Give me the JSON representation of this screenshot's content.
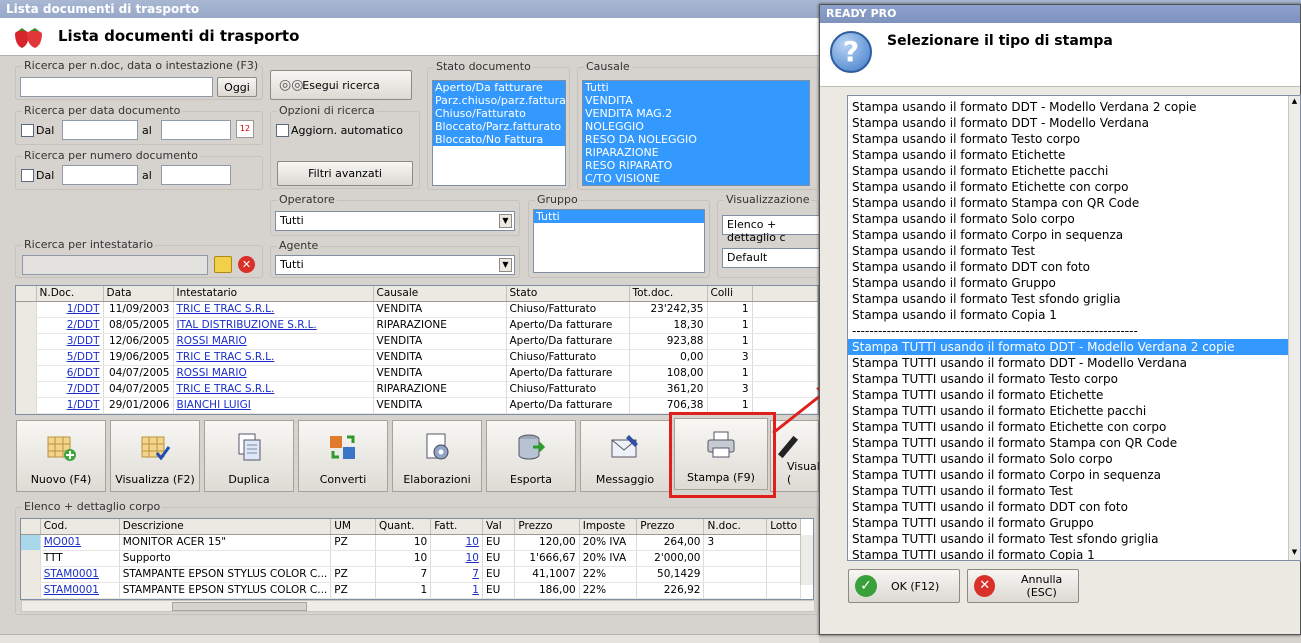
{
  "window": {
    "title": "Lista documenti di trasporto"
  },
  "header": {
    "title": "Lista documenti di trasporto"
  },
  "search": {
    "ndoc_label": "Ricerca per n.doc, data o intestazione (F3)",
    "ndoc_value": "",
    "oggi_label": "Oggi",
    "execute_label": "Esegui ricerca",
    "date_label": "Ricerca per data documento",
    "dal_label": "Dal",
    "al_label": "al",
    "num_label": "Ricerca per numero documento",
    "options_label": "Opzioni di ricerca",
    "auto_update_label": "Aggiorn. automatico",
    "advanced_filters_label": "Filtri avanzati",
    "intestatario_label": "Ricerca per intestatario"
  },
  "stato": {
    "label": "Stato documento",
    "items": [
      "Aperto/Da fatturare",
      "Parz.chiuso/parz.fatturato",
      "Chiuso/Fatturato",
      "Bloccato/Parz.fatturato",
      "Bloccato/No Fattura"
    ]
  },
  "causale": {
    "label": "Causale",
    "items": [
      "Tutti",
      "VENDITA",
      "VENDITA MAG.2",
      "NOLEGGIO",
      "RESO DA NOLEGGIO",
      "RIPARAZIONE",
      "RESO RIPARATO",
      "C/TO VISIONE"
    ]
  },
  "operatore": {
    "label": "Operatore",
    "value": "Tutti"
  },
  "agente": {
    "label": "Agente",
    "value": "Tutti"
  },
  "gruppo": {
    "label": "Gruppo",
    "items": [
      "Tutti"
    ]
  },
  "visualizzazione": {
    "label": "Visualizzazione",
    "value": "Elenco + dettaglio c",
    "value2": "Default"
  },
  "doc_table": {
    "headers": [
      "N.Doc.",
      "Data",
      "Intestatario",
      "Causale",
      "Stato",
      "Tot.doc.",
      "Colli"
    ],
    "rows": [
      [
        "1/DDT",
        "11/09/2003",
        "TRIC E TRAC S.R.L.",
        "VENDITA",
        "Chiuso/Fatturato",
        "23'242,35",
        "1"
      ],
      [
        "2/DDT",
        "08/05/2005",
        "ITAL DISTRIBUZIONE S.R.L.",
        "RIPARAZIONE",
        "Aperto/Da fatturare",
        "18,30",
        "1"
      ],
      [
        "3/DDT",
        "12/06/2005",
        "ROSSI MARIO",
        "VENDITA",
        "Aperto/Da fatturare",
        "923,88",
        "1"
      ],
      [
        "5/DDT",
        "19/06/2005",
        "TRIC E TRAC S.R.L.",
        "VENDITA",
        "Chiuso/Fatturato",
        "0,00",
        "3"
      ],
      [
        "6/DDT",
        "04/07/2005",
        "ROSSI MARIO",
        "VENDITA",
        "Aperto/Da fatturare",
        "108,00",
        "1"
      ],
      [
        "7/DDT",
        "04/07/2005",
        "TRIC E TRAC S.R.L.",
        "RIPARAZIONE",
        "Chiuso/Fatturato",
        "361,20",
        "3"
      ],
      [
        "1/DDT",
        "29/01/2006",
        "BIANCHI LUIGI",
        "VENDITA",
        "Aperto/Da fatturare",
        "706,38",
        "1"
      ]
    ]
  },
  "toolbar": {
    "buttons": [
      "Nuovo (F4)",
      "Visualizza (F2)",
      "Duplica",
      "Converti",
      "Elaborazioni",
      "Esporta",
      "Messaggio",
      "Stampa (F9)",
      "Visual ("
    ]
  },
  "detail": {
    "label": "Elenco + dettaglio corpo",
    "headers": [
      "Cod.",
      "Descrizione",
      "UM",
      "Quant.",
      "Fatt.",
      "Val",
      "Prezzo",
      "Imposte",
      "Prezzo",
      "N.doc.",
      "Lotto"
    ],
    "rows": [
      [
        "MO001",
        "MONITOR ACER 15\"",
        "PZ",
        "10",
        "10",
        "EU",
        "120,00",
        "20% IVA",
        "264,00",
        "3",
        ""
      ],
      [
        "TTT",
        "Supporto",
        "",
        "10",
        "10",
        "EU",
        "1'666,67",
        "20% IVA",
        "2'000,00",
        "",
        ""
      ],
      [
        "STAM0001",
        "STAMPANTE EPSON STYLUS COLOR C...",
        "PZ",
        "7",
        "7",
        "EU",
        "41,1007",
        "22%",
        "50,1429",
        "",
        ""
      ],
      [
        "STAM0001",
        "STAMPANTE EPSON STYLUS COLOR C...",
        "PZ",
        "1",
        "1",
        "EU",
        "186,00",
        "22%",
        "226,92",
        "",
        ""
      ]
    ]
  },
  "dialog": {
    "title": "READY PRO",
    "heading": "Selezionare il tipo di stampa",
    "items": [
      "Stampa usando il formato DDT - Modello Verdana 2 copie",
      "Stampa usando il formato DDT - Modello Verdana",
      "Stampa usando il formato Testo corpo",
      "Stampa usando il formato Etichette",
      "Stampa usando il formato Etichette pacchi",
      "Stampa usando il formato Etichette con corpo",
      "Stampa usando il formato Stampa con QR Code",
      "Stampa usando il formato Solo corpo",
      "Stampa usando il formato Corpo in sequenza",
      "Stampa usando il formato Test",
      "Stampa usando il formato DDT con foto",
      "Stampa usando il formato Gruppo",
      "Stampa usando il formato Test sfondo griglia",
      "Stampa usando il formato Copia 1",
      "------------------------------------------------------------------",
      "Stampa TUTTI usando il formato DDT - Modello Verdana 2 copie",
      "Stampa TUTTI usando il formato DDT - Modello Verdana",
      "Stampa TUTTI usando il formato Testo corpo",
      "Stampa TUTTI usando il formato Etichette",
      "Stampa TUTTI usando il formato Etichette pacchi",
      "Stampa TUTTI usando il formato Etichette con corpo",
      "Stampa TUTTI usando il formato Stampa con QR Code",
      "Stampa TUTTI usando il formato Solo corpo",
      "Stampa TUTTI usando il formato Corpo in sequenza",
      "Stampa TUTTI usando il formato Test",
      "Stampa TUTTI usando il formato DDT con foto",
      "Stampa TUTTI usando il formato Gruppo",
      "Stampa TUTTI usando il formato Test sfondo griglia",
      "Stampa TUTTI usando il formato Copia 1"
    ],
    "selected_index": 15,
    "ok_label": "OK (F12)",
    "cancel_label": "Annulla (ESC)"
  }
}
